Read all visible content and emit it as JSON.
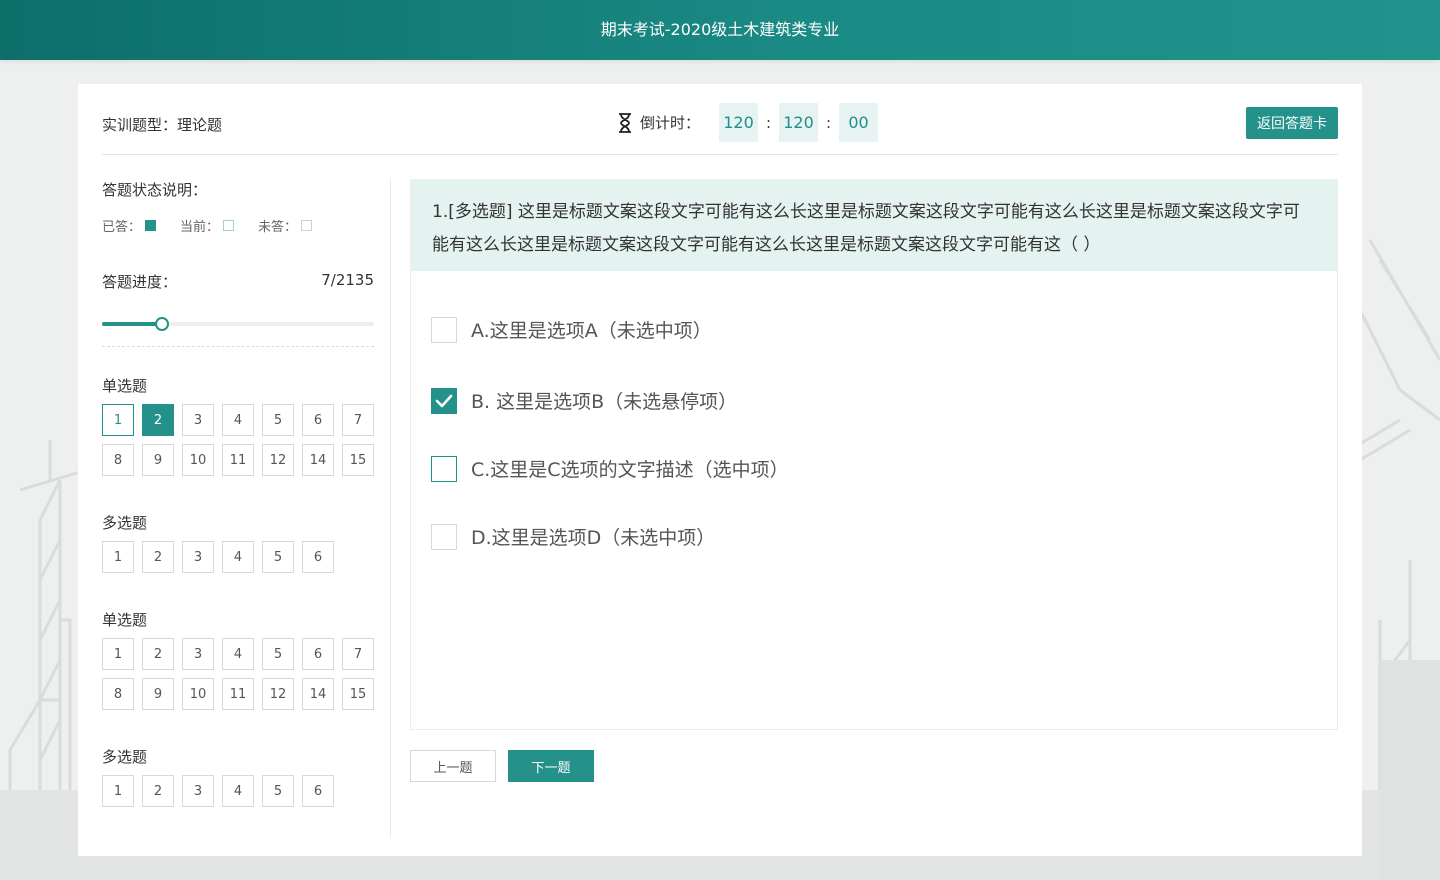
{
  "page": {
    "title": "期末考试-2020级土木建筑类专业"
  },
  "header": {
    "question_type": "实训题型：理论题",
    "countdown_label": "倒计时：",
    "countdown": {
      "hours": "120",
      "minutes": "120",
      "seconds": "00"
    },
    "return_button": "返回答题卡"
  },
  "sidebar": {
    "status_title": "答题状态说明：",
    "legend": {
      "answered": "已答：",
      "current": "当前：",
      "unanswered": "未答："
    },
    "progress_label": "答题进度：",
    "progress_text": "7/2135",
    "progress_fraction": 0.22,
    "groups": [
      {
        "title": "单选题",
        "items": [
          {
            "n": "1",
            "state": "current"
          },
          {
            "n": "2",
            "state": "done"
          },
          {
            "n": "3",
            "state": ""
          },
          {
            "n": "4",
            "state": ""
          },
          {
            "n": "5",
            "state": ""
          },
          {
            "n": "6",
            "state": ""
          },
          {
            "n": "7",
            "state": ""
          },
          {
            "n": "8",
            "state": ""
          },
          {
            "n": "9",
            "state": ""
          },
          {
            "n": "10",
            "state": ""
          },
          {
            "n": "11",
            "state": ""
          },
          {
            "n": "12",
            "state": ""
          },
          {
            "n": "14",
            "state": ""
          },
          {
            "n": "15",
            "state": ""
          }
        ]
      },
      {
        "title": "多选题",
        "items": [
          {
            "n": "1",
            "state": ""
          },
          {
            "n": "2",
            "state": ""
          },
          {
            "n": "3",
            "state": ""
          },
          {
            "n": "4",
            "state": ""
          },
          {
            "n": "5",
            "state": ""
          },
          {
            "n": "6",
            "state": ""
          }
        ]
      },
      {
        "title": "单选题",
        "items": [
          {
            "n": "1",
            "state": ""
          },
          {
            "n": "2",
            "state": ""
          },
          {
            "n": "3",
            "state": ""
          },
          {
            "n": "4",
            "state": ""
          },
          {
            "n": "5",
            "state": ""
          },
          {
            "n": "6",
            "state": ""
          },
          {
            "n": "7",
            "state": ""
          },
          {
            "n": "8",
            "state": ""
          },
          {
            "n": "9",
            "state": ""
          },
          {
            "n": "10",
            "state": ""
          },
          {
            "n": "11",
            "state": ""
          },
          {
            "n": "12",
            "state": ""
          },
          {
            "n": "14",
            "state": ""
          },
          {
            "n": "15",
            "state": ""
          }
        ]
      },
      {
        "title": "多选题",
        "items": [
          {
            "n": "1",
            "state": ""
          },
          {
            "n": "2",
            "state": ""
          },
          {
            "n": "3",
            "state": ""
          },
          {
            "n": "4",
            "state": ""
          },
          {
            "n": "5",
            "state": ""
          },
          {
            "n": "6",
            "state": ""
          }
        ]
      }
    ]
  },
  "question": {
    "stem": "1.[多选题]  这里是标题文案这段文字可能有这么长这里是标题文案这段文字可能有这么长这里是标题文案这段文字可能有这么长这里是标题文案这段文字可能有这么长这里是标题文案这段文字可能有这（    ）",
    "options": [
      {
        "label": "A.这里是选项A（未选中项）",
        "state": "unchecked"
      },
      {
        "label": "B. 这里是选项B（未选悬停项）",
        "state": "checked"
      },
      {
        "label": "C.这里是C选项的文字描述（选中项）",
        "state": "active"
      },
      {
        "label": "D.这里是选项D（未选中项）",
        "state": "unchecked"
      }
    ]
  },
  "nav": {
    "prev": "上一题",
    "next": "下一题"
  },
  "colors": {
    "accent": "#24918a",
    "header_start": "#0d6e6a",
    "header_end": "#22938c",
    "stem_bg": "#e4f2f0"
  }
}
